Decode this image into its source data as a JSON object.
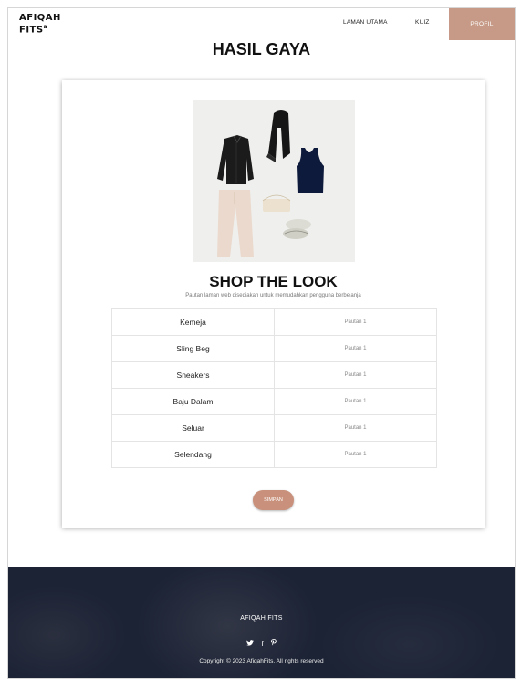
{
  "header": {
    "logo_line1": "AFIQAH",
    "logo_line2": "FITS",
    "logo_mark": "a",
    "nav": {
      "home": "LAMAN UTAMA",
      "quiz": "KUIZ",
      "profile": "PROFIL"
    }
  },
  "page_title": "HASIL GAYA",
  "look": {
    "title": "SHOP THE LOOK",
    "subtitle": "Pautan laman web disediakan untuk memudahkan pengguna berbelanja",
    "items": [
      {
        "name": "Kemeja",
        "link": "Pautan 1"
      },
      {
        "name": "Sling Beg",
        "link": "Pautan 1"
      },
      {
        "name": "Sneakers",
        "link": "Pautan 1"
      },
      {
        "name": "Baju Dalam",
        "link": "Pautan 1"
      },
      {
        "name": "Seluar",
        "link": "Pautan 1"
      },
      {
        "name": "Selendang",
        "link": "Pautan 1"
      }
    ],
    "save_label": "SIMPAN"
  },
  "footer": {
    "brand": "AFIQAH FITS",
    "social": {
      "twitter": "🐦",
      "facebook": "f",
      "pinterest": "P"
    },
    "copyright": "Copyright © 2023 AfiqahFits. All rights reserved"
  },
  "colors": {
    "accent": "#c69a86",
    "button": "#c9917b",
    "footer_bg": "#1c2335"
  }
}
